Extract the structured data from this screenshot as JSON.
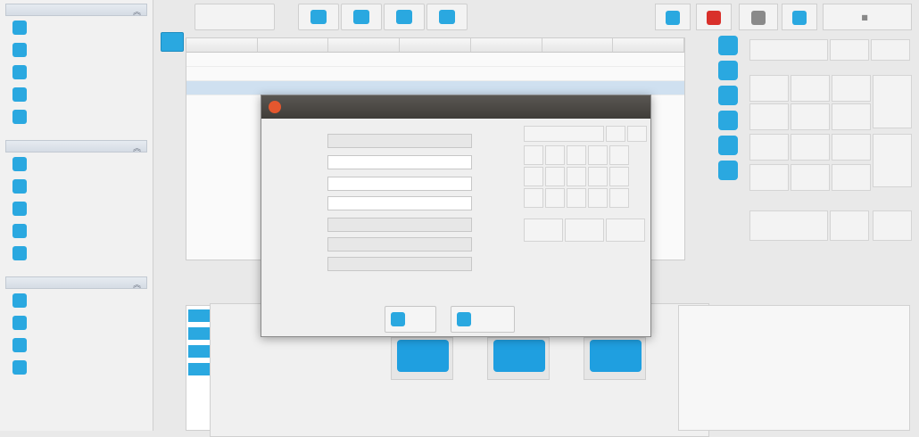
{
  "colors": {
    "accent": "#2aa8e0",
    "danger": "#d9302b",
    "title_bar": "#46433f"
  },
  "sidebar": {
    "sections": [
      {
        "title": "",
        "items": [
          {
            "label": "",
            "icon": "document-icon"
          },
          {
            "label": "",
            "icon": "list-icon"
          },
          {
            "label": "",
            "icon": "transfer-icon"
          },
          {
            "label": "",
            "icon": "money-icon"
          },
          {
            "label": "",
            "icon": "box-icon"
          }
        ]
      },
      {
        "title": "",
        "items": [
          {
            "label": "",
            "icon": "users-icon"
          },
          {
            "label": "",
            "icon": "building-icon"
          },
          {
            "label": "",
            "icon": "user-icon"
          },
          {
            "label": "",
            "icon": "tag-icon"
          },
          {
            "label": "",
            "icon": "globe-icon"
          }
        ]
      },
      {
        "title": "",
        "items": [
          {
            "label": "",
            "icon": "key-icon"
          },
          {
            "label": "",
            "icon": "gear-icon"
          },
          {
            "label": "",
            "icon": "printer-icon"
          },
          {
            "label": "",
            "icon": "database-icon"
          }
        ]
      }
    ]
  },
  "toolbar": {
    "search_label": ""
  },
  "table": {
    "columns": [
      "",
      "",
      "",
      "",
      "",
      "",
      ""
    ]
  },
  "actions": {
    "left": "",
    "middle": "",
    "right": ""
  },
  "dialog": {
    "title": "",
    "fields": [
      {
        "label": "",
        "value": ""
      },
      {
        "label": "",
        "value": ""
      },
      {
        "label": "",
        "value": ""
      },
      {
        "label": "",
        "value": ""
      },
      {
        "label": "",
        "value": ""
      },
      {
        "label": "",
        "value": ""
      },
      {
        "label": "",
        "value": ""
      }
    ],
    "keypad": [
      "",
      "",
      "",
      "",
      "",
      "",
      "",
      "",
      "",
      "",
      "",
      "",
      "",
      "",
      "",
      "",
      "",
      ""
    ],
    "ok_label": "",
    "cancel_label": ""
  },
  "sub_panel": {
    "value": ""
  },
  "top_right": {
    "login_label": ""
  }
}
